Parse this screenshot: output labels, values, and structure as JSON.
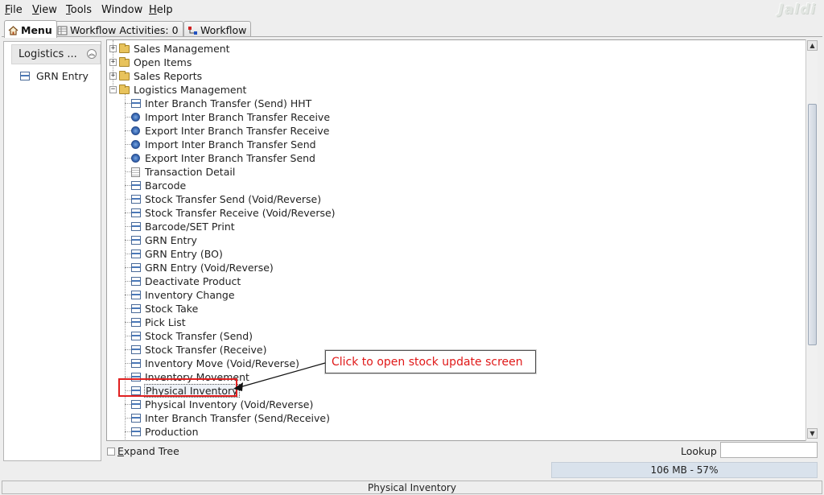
{
  "menubar": {
    "items": [
      {
        "mnemonic": "F",
        "rest": "ile"
      },
      {
        "mnemonic": "V",
        "rest": "iew"
      },
      {
        "mnemonic": "T",
        "rest": "ools"
      },
      {
        "mnemonic": "",
        "rest": "Window"
      },
      {
        "mnemonic": "H",
        "rest": "elp"
      }
    ],
    "logo": "Jaldi"
  },
  "tabs": [
    {
      "label": "Menu",
      "icon": "home-icon"
    },
    {
      "label": "Workflow Activities: 0",
      "icon": "table-icon"
    },
    {
      "label": "Workflow",
      "icon": "workflow-icon"
    }
  ],
  "left_panel": {
    "header": "Logistics ...",
    "items": [
      {
        "label": "GRN Entry",
        "icon": "window-icon"
      }
    ]
  },
  "tree": {
    "folders": [
      {
        "label": "Sales Management",
        "expanded": false
      },
      {
        "label": "Open Items",
        "expanded": false
      },
      {
        "label": "Sales Reports",
        "expanded": false
      },
      {
        "label": "Logistics Management",
        "expanded": true
      }
    ],
    "children": [
      {
        "label": "Inter Branch Transfer (Send) HHT",
        "icon": "window-icon"
      },
      {
        "label": "Import Inter Branch Transfer Receive",
        "icon": "gear-icon"
      },
      {
        "label": "Export Inter Branch Transfer Receive",
        "icon": "gear-icon"
      },
      {
        "label": "Import Inter Branch Transfer Send",
        "icon": "gear-icon"
      },
      {
        "label": "Export Inter Branch Transfer Send",
        "icon": "gear-icon"
      },
      {
        "label": "Transaction Detail",
        "icon": "document-icon"
      },
      {
        "label": "Barcode",
        "icon": "window-icon"
      },
      {
        "label": "Stock Transfer Send (Void/Reverse)",
        "icon": "window-icon"
      },
      {
        "label": "Stock Transfer Receive (Void/Reverse)",
        "icon": "window-icon"
      },
      {
        "label": "Barcode/SET Print",
        "icon": "window-icon"
      },
      {
        "label": "GRN Entry",
        "icon": "window-icon"
      },
      {
        "label": "GRN Entry (BO)",
        "icon": "window-icon"
      },
      {
        "label": "GRN Entry (Void/Reverse)",
        "icon": "window-icon"
      },
      {
        "label": "Deactivate Product",
        "icon": "window-icon"
      },
      {
        "label": "Inventory Change",
        "icon": "window-icon"
      },
      {
        "label": "Stock Take",
        "icon": "window-icon"
      },
      {
        "label": "Pick List",
        "icon": "window-icon"
      },
      {
        "label": "Stock Transfer (Send)",
        "icon": "window-icon"
      },
      {
        "label": "Stock Transfer (Receive)",
        "icon": "window-icon"
      },
      {
        "label": "Inventory Move (Void/Reverse)",
        "icon": "window-icon"
      },
      {
        "label": "Inventory Movement",
        "icon": "window-icon"
      },
      {
        "label": "Physical Inventory",
        "icon": "window-icon",
        "selected": true
      },
      {
        "label": "Physical Inventory (Void/Reverse)",
        "icon": "window-icon"
      },
      {
        "label": "Inter Branch Transfer (Send/Receive)",
        "icon": "window-icon"
      },
      {
        "label": "Production",
        "icon": "window-icon"
      }
    ]
  },
  "bottom": {
    "expand_tree_label": "Expand Tree",
    "expand_tree_mnemonic": "E",
    "lookup_label": "Lookup",
    "lookup_value": "",
    "memory": "106 MB - 57%"
  },
  "status_bar": {
    "text": "Physical Inventory"
  },
  "annotation": {
    "callout_text": "Click to open stock update screen",
    "color": "#e01818"
  }
}
